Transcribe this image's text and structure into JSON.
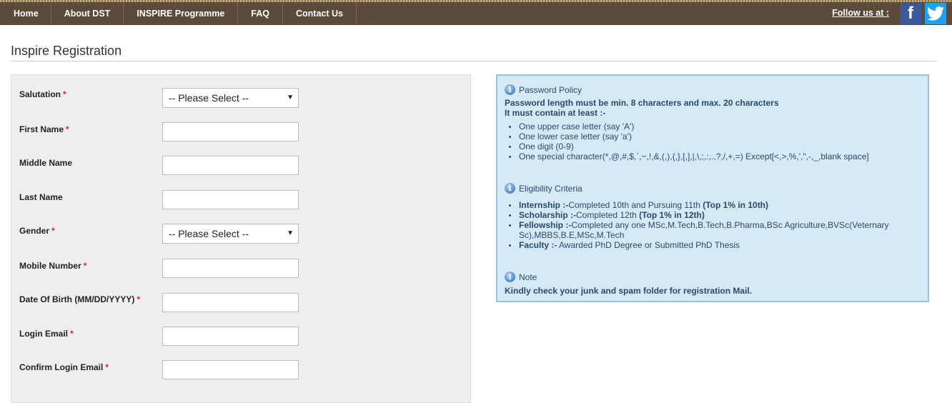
{
  "nav": {
    "items": [
      {
        "label": "Home"
      },
      {
        "label": "About DST"
      },
      {
        "label": "INSPIRE Programme"
      },
      {
        "label": "FAQ"
      },
      {
        "label": "Contact Us"
      }
    ],
    "follow_label": "Follow us at :",
    "social": {
      "facebook_glyph": "f",
      "twitter_icon": "twitter-bird"
    },
    "colors": {
      "bar": "#5c4a3a",
      "facebook": "#3b5998",
      "twitter": "#1da1f2"
    }
  },
  "page": {
    "title": "Inspire Registration"
  },
  "form": {
    "required_mark": "*",
    "fields": [
      {
        "label": "Salutation",
        "required": true,
        "type": "select",
        "value": "-- Please Select --"
      },
      {
        "label": "First Name",
        "required": true,
        "type": "text",
        "value": ""
      },
      {
        "label": "Middle Name",
        "required": false,
        "type": "text",
        "value": ""
      },
      {
        "label": "Last Name",
        "required": false,
        "type": "text",
        "value": ""
      },
      {
        "label": "Gender",
        "required": true,
        "type": "select",
        "value": "-- Please Select --"
      },
      {
        "label": "Mobile Number",
        "required": true,
        "type": "text",
        "value": ""
      },
      {
        "label": "Date Of Birth (MM/DD/YYYY)",
        "required": true,
        "type": "text",
        "value": ""
      },
      {
        "label": "Login Email",
        "required": true,
        "type": "text",
        "value": ""
      },
      {
        "label": "Confirm Login Email",
        "required": true,
        "type": "text",
        "value": ""
      }
    ],
    "select_arrow": "▼"
  },
  "info": {
    "password_policy": {
      "heading": "Password Policy",
      "line1": "Password length must be min. 8 characters and max. 20 characters",
      "line2": "It must contain at least :-",
      "items": [
        "One upper case letter (say 'A')",
        "One lower case letter (say 'a')",
        "One digit (0-9)",
        "One special character(*,@,#,$,`,~,!,&,(,),{,},[,],|,\\,;,:,.,?,/,+,=) Except[<,>,%,',\",-,_,blank space]"
      ]
    },
    "eligibility": {
      "heading": "Eligibility Criteria",
      "items": [
        {
          "term": "Internship :-",
          "text": "Completed 10th and Pursuing 11th ",
          "emphasis": "(Top 1% in 10th)"
        },
        {
          "term": "Scholarship :-",
          "text": "Completed 12th ",
          "emphasis": "(Top 1% in 12th)"
        },
        {
          "term": "Fellowship :-",
          "text": "Completed any one MSc,M.Tech,B.Tech,B.Pharma,BSc Agriculture,BVSc(Veternary Sc),MBBS,B.E,MSc,M.Tech",
          "emphasis": ""
        },
        {
          "term": "Faculty :-",
          "text": " Awarded PhD Degree or Submitted PhD Thesis",
          "emphasis": ""
        }
      ]
    },
    "note": {
      "heading": "Note",
      "text": "Kindly check your junk and spam folder for registration Mail."
    }
  }
}
